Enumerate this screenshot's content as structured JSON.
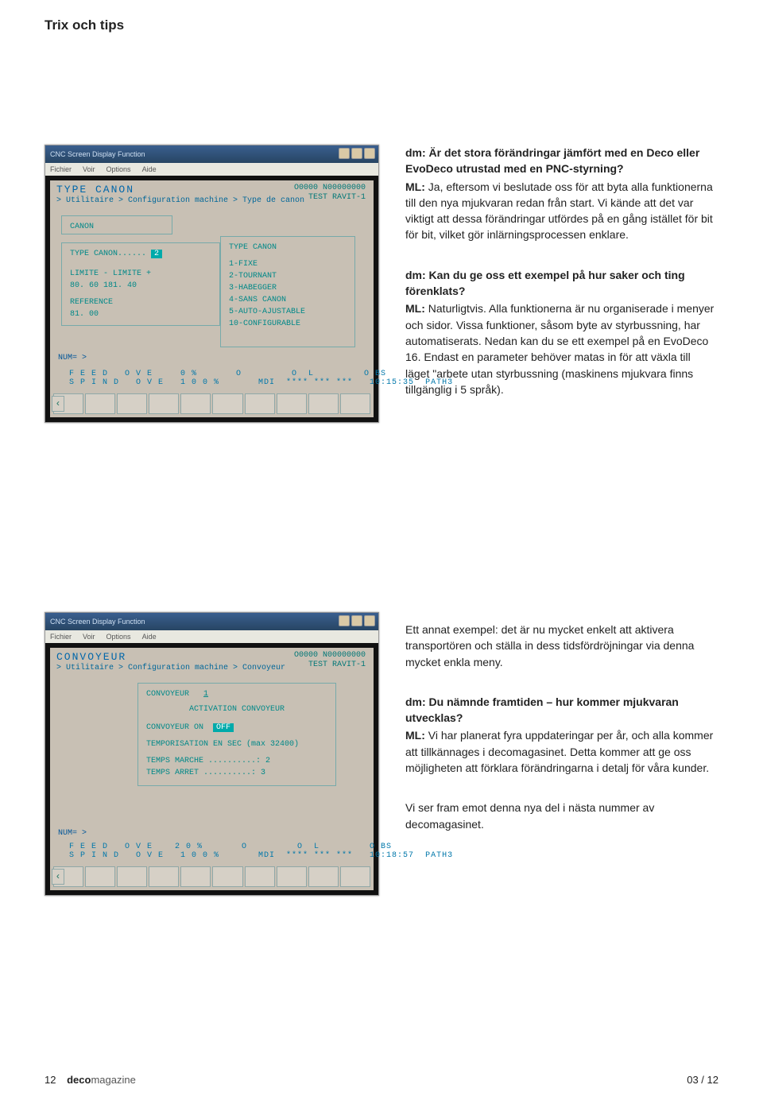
{
  "header": {
    "section": "Trix och tips"
  },
  "article": {
    "q1": {
      "q": "dm: Är det stora förändringar jämfört med en Deco eller EvoDeco utrustad med en PNC-styrning?",
      "aLabel": "ML:",
      "aText": " Ja, eftersom vi beslutade oss för att byta alla funktionerna till den nya mjukvaran redan från start. Vi kände att det var viktigt att dessa förändringar utfördes på en gång istället för bit för bit, vilket gör inlärningsprocessen enklare."
    },
    "q2": {
      "q": "dm: Kan du ge oss ett exempel på hur saker och ting förenklats?",
      "aLabel": "ML:",
      "aText": " Naturligtvis. Alla funktionerna är nu organiserade i menyer och sidor. Vissa funktioner, såsom byte av styrbussning, har automatiserats. Nedan kan du se ett exempel på en EvoDeco 16. Endast en parameter behöver matas in för att växla till läget \"arbete utan styrbussning (maskinens mjukvara finns tillgänglig i 5 språk)."
    },
    "p3": "Ett annat exempel: det är nu mycket enkelt att aktivera transportören och ställa in dess tidsfördröjningar via denna mycket enkla meny.",
    "q4": {
      "q": "dm: Du nämnde framtiden – hur kommer mjukvaran utvecklas?",
      "aLabel": "ML:",
      "aText": " Vi har planerat fyra uppdateringar per år, och alla kommer att tillkännages i decomagasinet. Detta kommer att ge oss möjligheten att förklara förändringarna i detalj för våra kunder."
    },
    "p5": "Vi ser fram emot denna nya del i nästa nummer av decomagasinet."
  },
  "screenshot1": {
    "winTitle": "CNC Screen Display Function",
    "menu": [
      "Fichier",
      "Voir",
      "Options",
      "Aide"
    ],
    "title": "TYPE  CANON",
    "topRight1": "O0000 N00000000",
    "topRight2": "TEST RAVIT-1",
    "path": "> Utilitaire > Configuration machine > Type de canon",
    "box1": "CANON",
    "box2a": "TYPE CANON......",
    "box2num": "2",
    "box2b": "LIMITE -    LIMITE +",
    "box2c": "  80. 60    181. 40",
    "box2d": "    REFERENCE",
    "box2e": "     81. 00",
    "box3title": "TYPE CANON",
    "box3items": [
      "1-FIXE",
      "2-TOURNANT",
      "3-HABEGGER",
      "4-SANS CANON",
      "5-AUTO-AJUSTABLE",
      "",
      "10-CONFIGURABLE"
    ],
    "num": "NUM= >",
    "feed": "  F E E D   O V E     0 %       O         O  L         O BS\n  S P I N D   O V E   1 0 0 %       MDI  **** *** ***   10:15:35  PATH3",
    "arrow": "‹"
  },
  "screenshot2": {
    "winTitle": "CNC Screen Display Function",
    "menu": [
      "Fichier",
      "Voir",
      "Options",
      "Aide"
    ],
    "title": "CONVOYEUR",
    "topRight1": "O0000 N00000000",
    "topRight2": "TEST RAVIT-1",
    "path": "> Utilitaire > Configuration machine > Convoyeur",
    "convLabel": "CONVOYEUR",
    "convVal": "1",
    "act": "ACTIVATION CONVOYEUR",
    "convLine": "CONVOYEUR            ON",
    "off": "OFF",
    "temp": "TEMPORISATION EN SEC (max 32400)",
    "marche": "TEMPS MARCHE ..........:   2",
    "arret": "TEMPS ARRET  ..........:   3",
    "num": "NUM= >",
    "feed": "  F E E D   O V E    2 0 %       O         O  L         O BS\n  S P I N D   O V E   1 0 0 %       MDI  **** *** ***   10:18:57  PATH3",
    "arrow": "‹"
  },
  "footer": {
    "pageNum": "12",
    "brandA": "deco",
    "brandB": "magazine",
    "issue": "03 / 12"
  }
}
